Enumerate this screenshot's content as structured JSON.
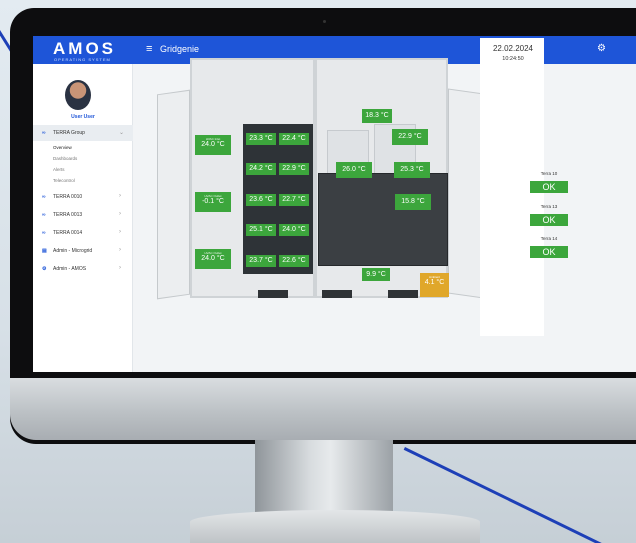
{
  "app": {
    "logo": "AMOS",
    "logo_sub": "OPERATING SYSTEM",
    "title": "Gridgenie"
  },
  "user": {
    "name": "User User"
  },
  "sidebar": {
    "group": "TERRA Group",
    "subitems": [
      "Overview",
      "Dashboards",
      "Alerts",
      "Telecontrol"
    ],
    "items": [
      {
        "label": "TERRA 0010",
        "icon": "link-icon"
      },
      {
        "label": "TERRA 0013",
        "icon": "link-icon"
      },
      {
        "label": "TERRA 0014",
        "icon": "link-icon"
      },
      {
        "label": "Admin - Microgrid",
        "icon": "building-icon"
      },
      {
        "label": "Admin - AMOS",
        "icon": "gear-icon"
      }
    ]
  },
  "panel": {
    "date": "22.02.2024",
    "time": "10:24:50",
    "statuses": [
      {
        "name": "Terra 10",
        "status": "OK"
      },
      {
        "name": "Terra 13",
        "status": "OK"
      },
      {
        "name": "Terra 14",
        "status": "OK"
      }
    ]
  },
  "sensors": {
    "hvac_1": {
      "label": "HVAC Inlet",
      "value": "24.0 °C"
    },
    "hvac_2": {
      "label": "HVAC Outlet",
      "value": "-0.1 °C"
    },
    "hvac_3": {
      "label": "HVAC Outlet",
      "value": "24.0 °C"
    },
    "r1": [
      "23.3 °C",
      "22.4 °C"
    ],
    "r2": [
      "24.2 °C",
      "22.9 °C"
    ],
    "r3": [
      "23.6 °C",
      "22.7 °C"
    ],
    "r4": [
      "25.1 °C",
      "24.0 °C"
    ],
    "r5": [
      "23.7 °C",
      "22.6 °C"
    ],
    "top": "18.3 °C",
    "inv_r": "22.9 °C",
    "inv_a": "26.0 °C",
    "inv_b": "25.3 °C",
    "mid": "15.8 °C",
    "ctrl": "9.9 °C",
    "warn": {
      "label": "Ambient",
      "value": "4.1 °C"
    }
  },
  "colors": {
    "accent": "#1e55d8",
    "ok": "#3ca63c",
    "warn": "#e0a72a"
  }
}
